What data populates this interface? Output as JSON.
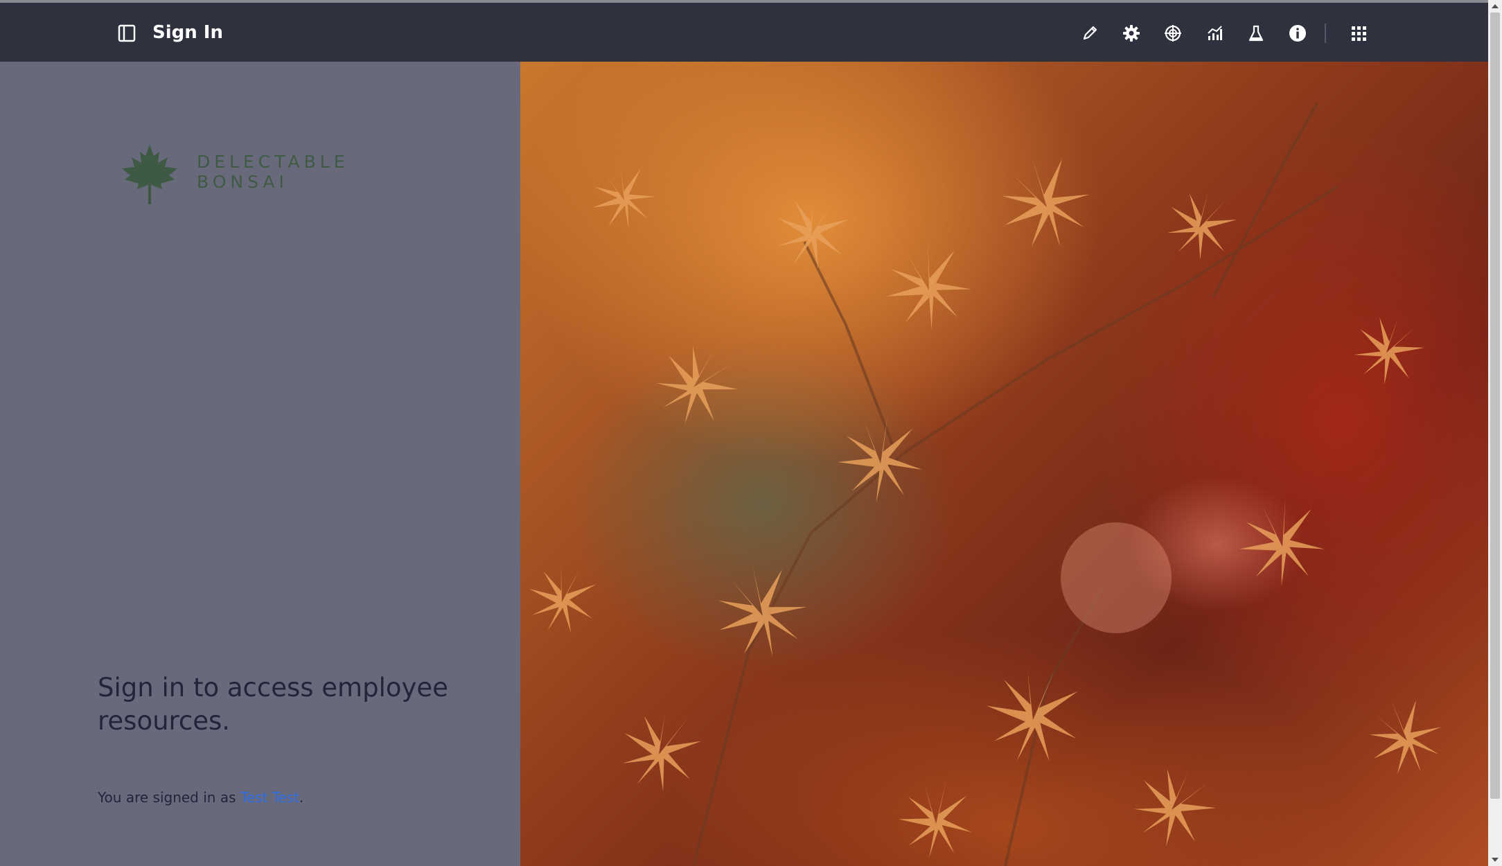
{
  "header": {
    "title": "Sign In",
    "sidebar_toggle_icon": "sidebar-toggle-icon",
    "toolbar": [
      {
        "name": "edit-button",
        "icon": "pencil-icon"
      },
      {
        "name": "settings-button",
        "icon": "gear-icon"
      },
      {
        "name": "target-button",
        "icon": "crosshair-icon"
      },
      {
        "name": "analytics-button",
        "icon": "chart-icon"
      },
      {
        "name": "lab-button",
        "icon": "flask-icon"
      },
      {
        "name": "info-button",
        "icon": "info-icon"
      },
      {
        "name": "apps-button",
        "icon": "grid-icon"
      }
    ]
  },
  "brand": {
    "line1": "DELECTABLE",
    "line2": "BONSAI",
    "logo_icon": "maple-leaf-icon",
    "color": "#3f5a44"
  },
  "main": {
    "headline": "Sign in to access employee resources.",
    "signed_in_prefix": "You are signed in as ",
    "user_name": "Test Test",
    "signed_in_suffix": "."
  },
  "colors": {
    "header_bg": "#2f313f",
    "panel_bg": "#686a7c",
    "link": "#2d6be3"
  }
}
